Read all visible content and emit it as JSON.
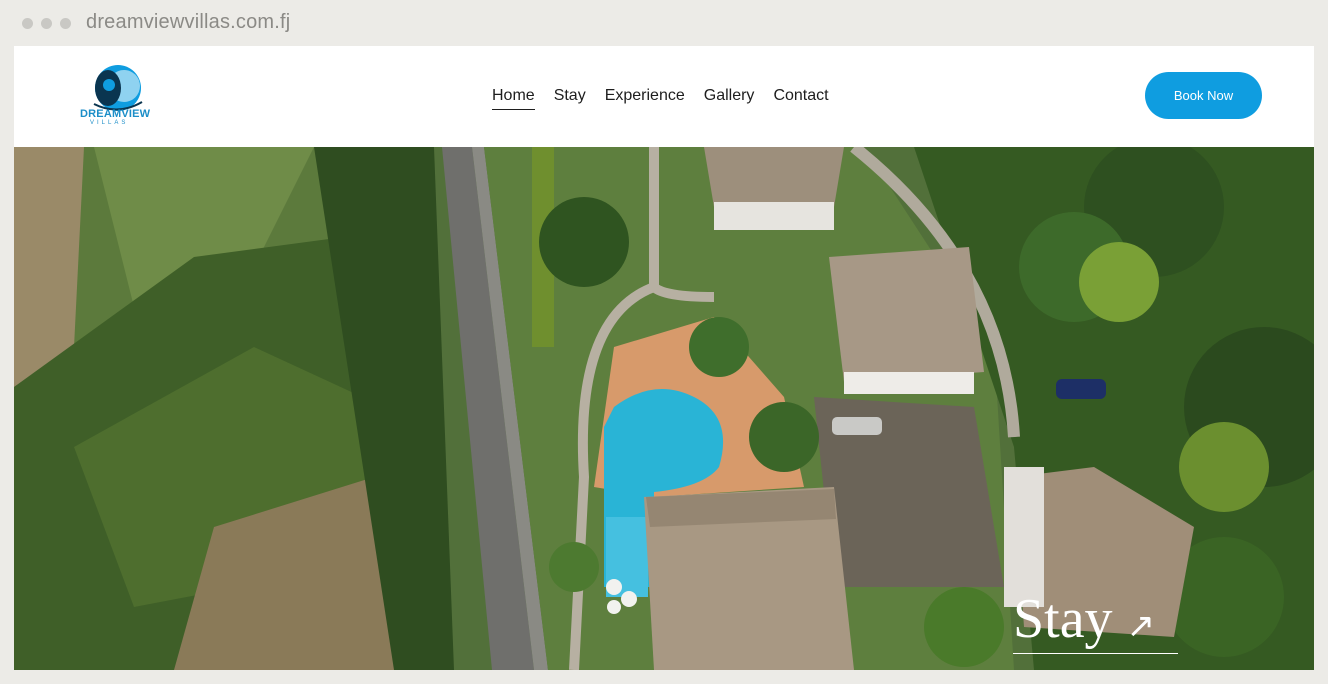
{
  "browser": {
    "url": "dreamviewvillas.com.fj"
  },
  "brand": {
    "name": "DREAMVIEW",
    "tagline": "VILLAS"
  },
  "nav": {
    "items": [
      {
        "label": "Home",
        "active": true
      },
      {
        "label": "Stay",
        "active": false
      },
      {
        "label": "Experience",
        "active": false
      },
      {
        "label": "Gallery",
        "active": false
      },
      {
        "label": "Contact",
        "active": false
      }
    ],
    "cta_label": "Book Now"
  },
  "hero": {
    "link_label": "Stay",
    "link_icon": "arrow-up-right-icon"
  },
  "colors": {
    "accent": "#0f9de0",
    "background": "#ecebe7",
    "pool": "#29b4d6"
  }
}
